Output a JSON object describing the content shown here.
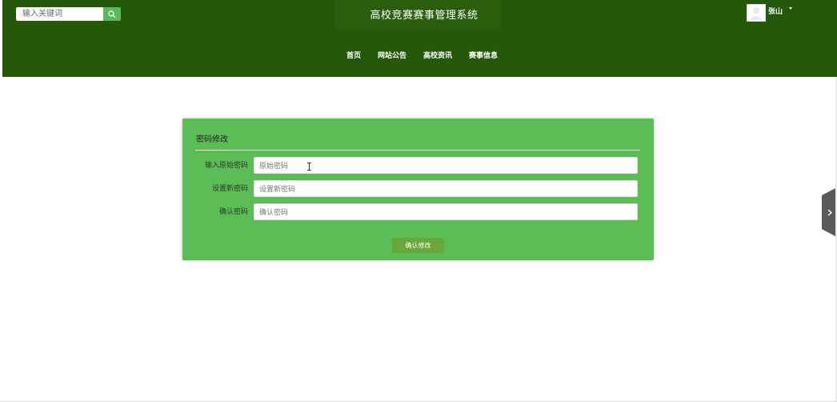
{
  "app": {
    "title": "高校竞赛赛事管理系统"
  },
  "search": {
    "placeholder": "输入关键词",
    "icon": "search-icon"
  },
  "user": {
    "name": "张山",
    "avatar_icon": "user-avatar-icon"
  },
  "nav": {
    "items": [
      {
        "label": "首页"
      },
      {
        "label": "网站公告"
      },
      {
        "label": "高校资讯"
      },
      {
        "label": "赛事信息"
      }
    ]
  },
  "form": {
    "title": "密码修改",
    "fields": [
      {
        "label": "输入原始密码",
        "placeholder": "原始密码",
        "value": ""
      },
      {
        "label": "设置新密码",
        "placeholder": "设置新密码",
        "value": ""
      },
      {
        "label": "确认密码",
        "placeholder": "确认密码",
        "value": ""
      }
    ],
    "submit_label": "确认修改"
  },
  "colors": {
    "header": "#25580a",
    "panel": "#5cbd56",
    "button": "#6aa73a",
    "search_button": "#5cb85c"
  }
}
